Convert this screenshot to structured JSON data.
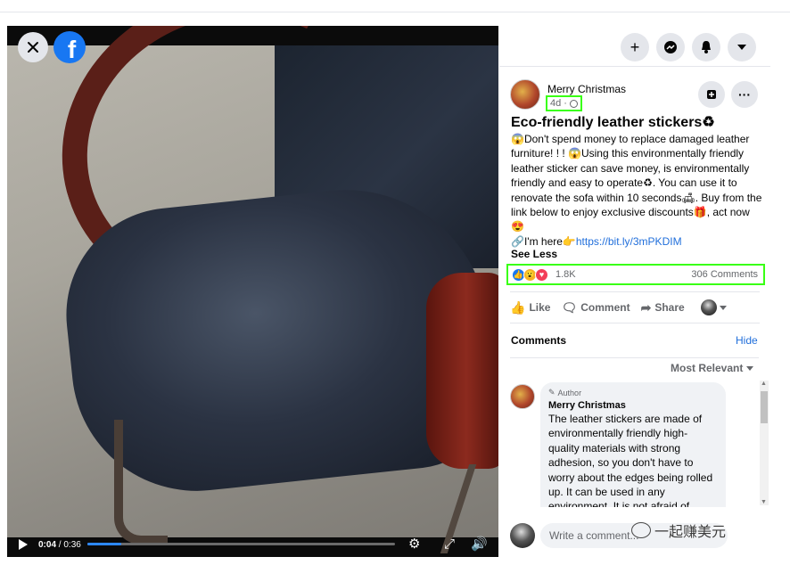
{
  "video": {
    "current_time": "0:04",
    "duration": "0:36",
    "progress_fraction": 0.11
  },
  "post": {
    "author": "Merry Christmas",
    "age": "4d",
    "title": "Eco-friendly leather stickers♻",
    "body_lines": [
      "😱Don't spend money to replace damaged leather furniture! ! ! 😱Using this environmentally friendly leather sticker can save money, is environmentally friendly and easy to operate♻. You can use it to renovate the sofa within 10 seconds🛋. Buy from the link below to enjoy exclusive discounts🎁, act now😍"
    ],
    "link_prefix": "🔗I'm here👉",
    "link_text": "https://bit.ly/3mPKDIM",
    "see_less": "See Less",
    "reaction_count": "1.8K",
    "comment_count": "306 Comments"
  },
  "actions": {
    "like": "Like",
    "comment": "Comment",
    "share": "Share"
  },
  "comments_section": {
    "label": "Comments",
    "hide": "Hide",
    "sort": "Most Relevant",
    "first_comment": {
      "badge": "Author",
      "name": "Merry Christmas",
      "text": "The leather stickers are made of environmentally friendly high-quality materials with strong adhesion, so you don't have to worry about the edges being rolled up. It can be used in any environment. It is not afraid of"
    },
    "write_placeholder": "Write a comment..."
  },
  "watermark": {
    "text": "一起赚美元"
  },
  "colors": {
    "facebook_blue": "#1877f2",
    "highlight_green": "#39ff14",
    "link_blue": "#216fdb"
  }
}
